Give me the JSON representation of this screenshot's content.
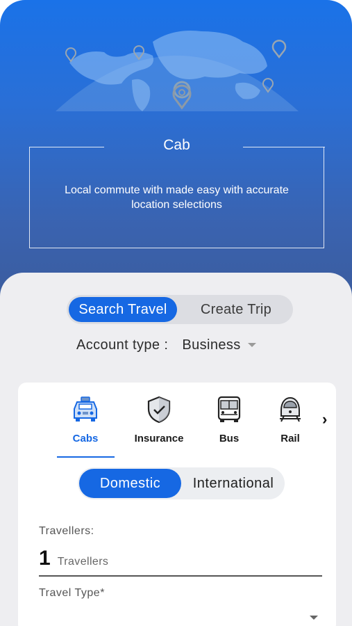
{
  "hero": {
    "title": "Cab",
    "description": "Local commute with made easy with accurate location selections"
  },
  "top_toggle": {
    "options": [
      {
        "label": "Search Travel",
        "selected": true
      },
      {
        "label": "Create Trip",
        "selected": false
      }
    ]
  },
  "account": {
    "label": "Account type :",
    "value": "Business"
  },
  "categories": {
    "items": [
      {
        "label": "Cabs",
        "icon": "cab-icon",
        "selected": true
      },
      {
        "label": "Insurance",
        "icon": "shield-check-icon",
        "selected": false
      },
      {
        "label": "Bus",
        "icon": "bus-icon",
        "selected": false
      },
      {
        "label": "Rail",
        "icon": "train-icon",
        "selected": false
      }
    ],
    "next_icon": "chevron-right-icon",
    "next_glyph": "›"
  },
  "trip_scope": {
    "options": [
      {
        "label": "Domestic",
        "selected": true
      },
      {
        "label": "International",
        "selected": false
      }
    ]
  },
  "travellers": {
    "label": "Travellers:",
    "count": "1",
    "unit": "Travellers"
  },
  "travel_type": {
    "label": "Travel Type*",
    "value": ""
  },
  "colors": {
    "accent": "#1668e3",
    "hero_top": "#1a72e8",
    "hero_bottom": "#3b5c9e",
    "sheet_bg": "#eeeef1"
  }
}
